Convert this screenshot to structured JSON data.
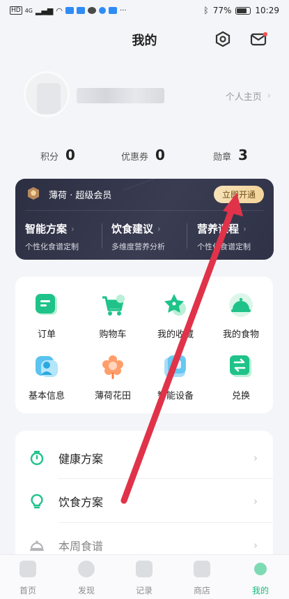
{
  "status_bar": {
    "network_labels": [
      "HD",
      "4G"
    ],
    "battery": "77%",
    "time": "10:29",
    "more": "···"
  },
  "header": {
    "title": "我的",
    "settings_icon": "hexagon-settings-icon",
    "message_icon": "mail-icon"
  },
  "profile": {
    "home_link": "个人主页"
  },
  "stats": [
    {
      "label": "积分",
      "value": "0"
    },
    {
      "label": "优惠券",
      "value": "0"
    },
    {
      "label": "勋章",
      "value": "3"
    }
  ],
  "vip": {
    "title": "薄荷 · 超级会员",
    "open_button": "立即开通",
    "features": [
      {
        "title": "智能方案",
        "subtitle": "个性化食谱定制"
      },
      {
        "title": "饮食建议",
        "subtitle": "多维度营养分析"
      },
      {
        "title": "营养课程",
        "subtitle": "个性化食谱定制"
      }
    ]
  },
  "functions": [
    {
      "label": "订单",
      "icon": "order-icon"
    },
    {
      "label": "购物车",
      "icon": "cart-icon"
    },
    {
      "label": "我的收藏",
      "icon": "star-icon"
    },
    {
      "label": "我的食物",
      "icon": "food-cover-icon"
    },
    {
      "label": "基本信息",
      "icon": "profile-card-icon"
    },
    {
      "label": "薄荷花田",
      "icon": "flower-icon"
    },
    {
      "label": "智能设备",
      "icon": "device-icon"
    },
    {
      "label": "兑换",
      "icon": "exchange-icon"
    }
  ],
  "menu": [
    {
      "label": "健康方案",
      "icon": "timer-icon"
    },
    {
      "label": "饮食方案",
      "icon": "lightbulb-icon"
    },
    {
      "label": "本周食谱",
      "icon": "dish-icon"
    }
  ],
  "tabs": [
    {
      "label": "首页",
      "icon": "home-tab-icon"
    },
    {
      "label": "发现",
      "icon": "planet-tab-icon"
    },
    {
      "label": "记录",
      "icon": "notes-tab-icon"
    },
    {
      "label": "商店",
      "icon": "bag-tab-icon"
    },
    {
      "label": "我的",
      "icon": "me-tab-icon",
      "active": true
    }
  ],
  "colors": {
    "accent": "#16b97a",
    "vip_bg": "#2c2f42",
    "vip_button": "#f3d49a",
    "annotation_arrow": "#e0334a"
  }
}
